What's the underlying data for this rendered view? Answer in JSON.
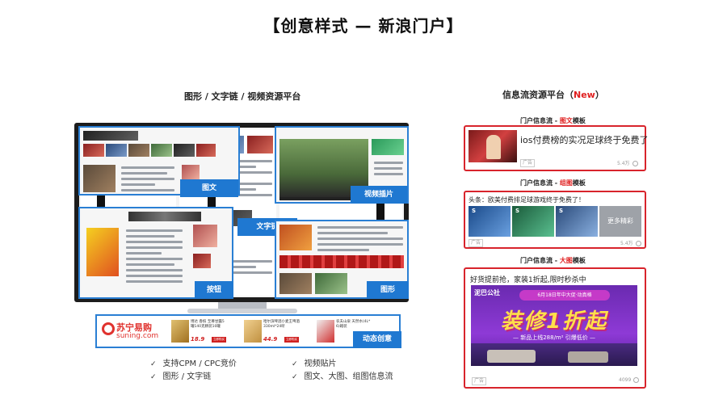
{
  "title": "【创意样式 — 新浪门户】",
  "left_section": {
    "title": "图形 / 文字链 / 视频资源平台",
    "labels": {
      "image_text": "图文",
      "video": "视频插片",
      "text_link": "文字链",
      "button": "按钮",
      "graphic": "图形",
      "dynamic": "动态创意"
    },
    "banner": {
      "brand_cn": "苏宁易购",
      "brand_en": "suning.com",
      "items": [
        {
          "text": "博达 香槟 至尊甘露5 罐140克精装10罐",
          "price": "18.9",
          "button": "立即购买"
        },
        {
          "text": "哈尔滨啤酒小麦王啤酒 330ml*24听",
          "price": "44.9",
          "button": "立即购买"
        },
        {
          "text": "农夫山泉 天然水(4L* 6)箱装",
          "price": "",
          "button": "立即购买"
        }
      ]
    },
    "features": [
      "支持CPM / CPC竞价",
      "视频贴片",
      "图形 / 文字链",
      "图文、大图、组图信息流"
    ]
  },
  "right_section": {
    "title_prefix": "信息流资源平台（",
    "title_new": "New",
    "title_suffix": "）",
    "cards": [
      {
        "head_prefix": "门户信息流 - ",
        "head_type": "图文",
        "head_suffix": "模板",
        "title": "ios付费榜的实况足球终于免费了",
        "ad": "广告",
        "count": "5.4万"
      },
      {
        "head_prefix": "门户信息流 - ",
        "head_type": "组图",
        "head_suffix": "模板",
        "title": "头条：欧美付费排足球游戏终于免费了！",
        "more": "更多精彩",
        "ad": "广告",
        "count": "5.4万"
      },
      {
        "head_prefix": "门户信息流 - ",
        "head_type": "大图",
        "head_suffix": "模板",
        "title": "好货提前抢，家装1折起,限时秒杀中",
        "banner_brand": "泥巴公社",
        "banner_date": "6月18日年中大促·动真格",
        "banner_big": "装修1折起",
        "banner_sub": "— 新品上线288/m² 引爆低价 —",
        "ad": "广告",
        "count": "4099"
      }
    ]
  },
  "colors": {
    "highlight_blue": "#1f78d1",
    "card_red": "#d8242c",
    "new_red": "#e02020"
  }
}
